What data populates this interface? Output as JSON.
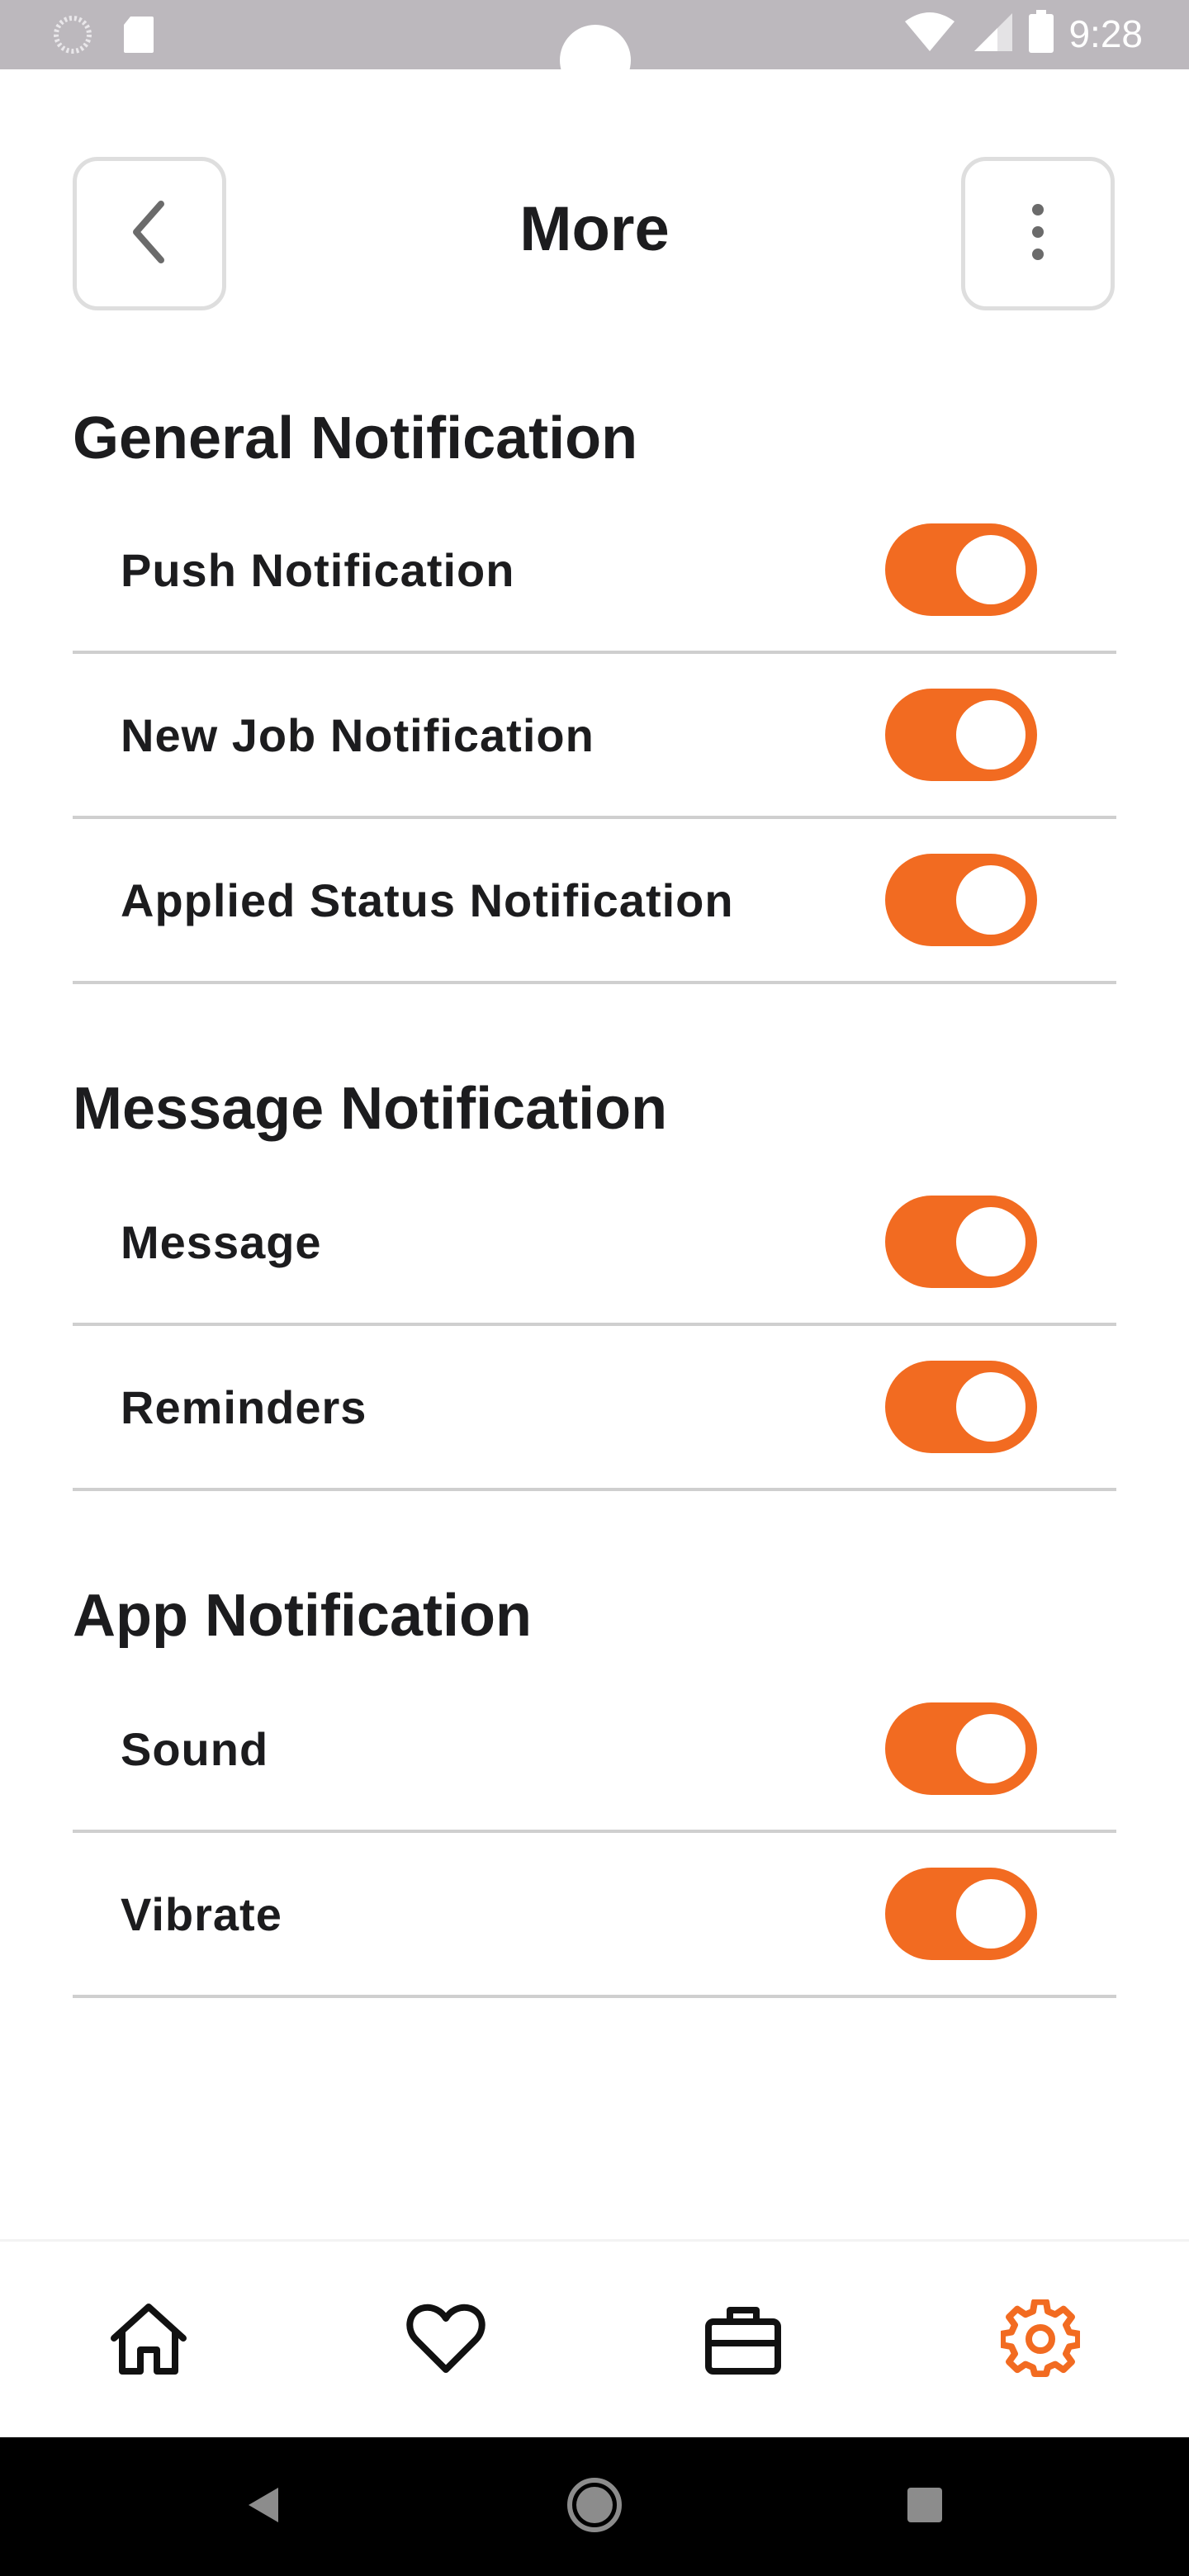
{
  "status_bar": {
    "time": "9:28",
    "icons": [
      "spinner-icon",
      "sd-card-icon",
      "wifi-icon",
      "signal-icon",
      "battery-icon"
    ]
  },
  "header": {
    "title": "More",
    "back_icon": "chevron-left-icon",
    "menu_icon": "vertical-dots-icon"
  },
  "sections": [
    {
      "title": "General Notification",
      "items": [
        {
          "label": "Push Notification",
          "enabled": true
        },
        {
          "label": "New Job Notification",
          "enabled": true
        },
        {
          "label": "Applied Status Notification",
          "enabled": true
        }
      ]
    },
    {
      "title": "Message Notification",
      "items": [
        {
          "label": "Message",
          "enabled": true
        },
        {
          "label": "Reminders",
          "enabled": true
        }
      ]
    },
    {
      "title": "App Notification",
      "items": [
        {
          "label": "Sound",
          "enabled": true
        },
        {
          "label": "Vibrate",
          "enabled": true
        }
      ]
    }
  ],
  "tab_bar": {
    "tabs": [
      {
        "icon": "home-icon",
        "active": false
      },
      {
        "icon": "heart-icon",
        "active": false
      },
      {
        "icon": "briefcase-icon",
        "active": false
      },
      {
        "icon": "gear-icon",
        "active": true
      }
    ]
  },
  "colors": {
    "accent": "#f26b21",
    "status_bar": "#bcb8bd",
    "divider": "#cfcfcf",
    "text": "#1c1c1e"
  }
}
